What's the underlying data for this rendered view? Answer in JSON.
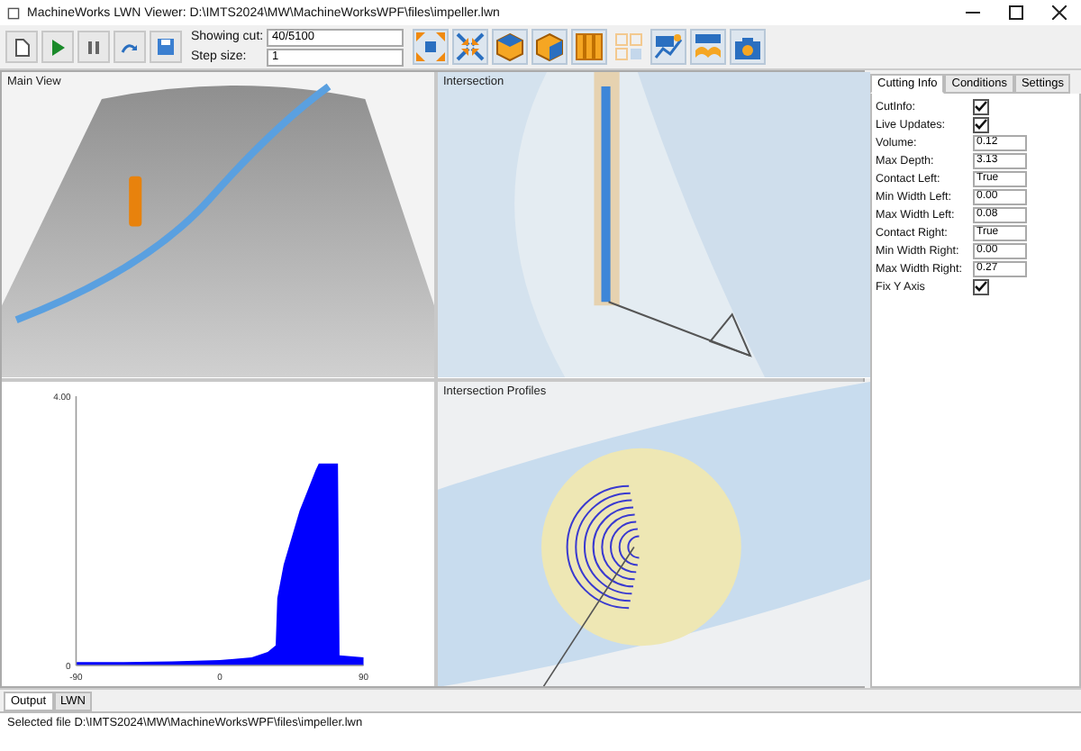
{
  "window": {
    "title": "MachineWorks LWN Viewer: D:\\IMTS2024\\MW\\MachineWorksWPF\\files\\impeller.lwn"
  },
  "toolbar": {
    "showing_cut": {
      "label": "Showing cut:",
      "value": "40/5100"
    },
    "step_size": {
      "label": "Step size:",
      "value": "1"
    }
  },
  "views": [
    {
      "kind": "main",
      "title": "Main View"
    },
    {
      "kind": "intersection",
      "title": "Intersection"
    },
    {
      "kind": "chart",
      "chart_data": {
        "type": "area",
        "x": [
          -90,
          -60,
          -30,
          0,
          20,
          30,
          35,
          36,
          40,
          45,
          50,
          55,
          60,
          62,
          74,
          75,
          90
        ],
        "series": [
          {
            "color": "#0000ff",
            "values": [
              0.05,
              0.05,
              0.06,
              0.08,
              0.12,
              0.2,
              0.3,
              1.0,
              1.5,
              1.9,
              2.3,
              2.6,
              2.9,
              3.0,
              3.0,
              0.15,
              0.12
            ]
          }
        ],
        "xlim": [
          -90,
          90
        ],
        "ylim": [
          0,
          4
        ],
        "xticks": [
          -90,
          0,
          90
        ],
        "yticks": [
          {
            "value": 0,
            "label": "0"
          },
          {
            "value": 4,
            "label": "4.00"
          }
        ]
      }
    },
    {
      "kind": "profiles",
      "title": "Intersection Profiles"
    }
  ],
  "side_panel": {
    "tabs": [
      {
        "label": "Cutting Info",
        "selected": true
      },
      {
        "label": "Conditions",
        "selected": false
      },
      {
        "label": "Settings",
        "selected": false
      }
    ],
    "properties": [
      {
        "kind": "checkbox",
        "label": "CutInfo:",
        "checked": true
      },
      {
        "kind": "checkbox",
        "label": "Live Updates:",
        "checked": true
      },
      {
        "kind": "text",
        "label": "Volume:",
        "value": "0.12"
      },
      {
        "kind": "text",
        "label": "Max Depth:",
        "value": "3.13"
      },
      {
        "kind": "text",
        "label": "Contact Left:",
        "value": "True"
      },
      {
        "kind": "text",
        "label": "Min Width Left:",
        "value": "0.00"
      },
      {
        "kind": "text",
        "label": "Max Width Left:",
        "value": "0.08"
      },
      {
        "kind": "text",
        "label": "Contact Right:",
        "value": "True"
      },
      {
        "kind": "text",
        "label": "Min Width Right:",
        "value": "0.00"
      },
      {
        "kind": "text",
        "label": "Max Width Right:",
        "value": "0.27"
      },
      {
        "kind": "checkbox",
        "label": "Fix Y Axis",
        "checked": true
      }
    ]
  },
  "bottom": {
    "tabs": [
      {
        "label": "Output",
        "selected": true
      },
      {
        "label": "LWN",
        "selected": false
      }
    ],
    "output_text": "Selected file D:\\IMTS2024\\MW\\MachineWorksWPF\\files\\impeller.lwn"
  }
}
